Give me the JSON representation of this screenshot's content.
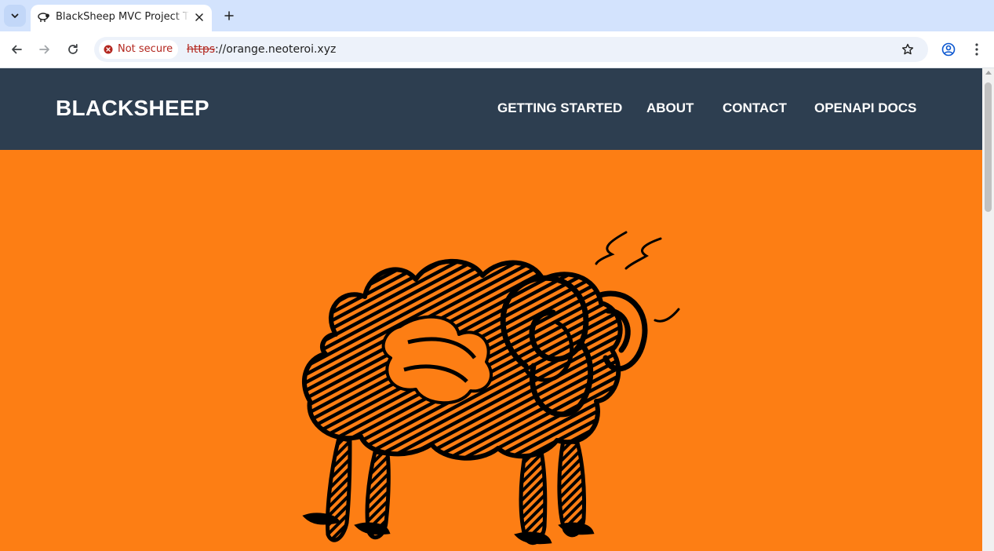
{
  "browser": {
    "tab": {
      "title": "BlackSheep MVC Project T",
      "favicon": "sheep-icon"
    },
    "security": {
      "label": "Not secure",
      "color": "#b3261e"
    },
    "address": {
      "scheme": "https",
      "rest": "://orange.neoteroi.xyz"
    },
    "icons": {
      "tab_search": "chevron-down-icon",
      "close": "close-icon",
      "new_tab": "plus-icon",
      "back": "back-arrow-icon",
      "forward": "forward-arrow-icon",
      "reload": "reload-icon",
      "bookmark": "star-icon",
      "profile": "profile-icon",
      "menu": "kebab-menu-icon"
    }
  },
  "page": {
    "brand": "BLACKSHEEP",
    "nav": [
      {
        "label": "GETTING STARTED"
      },
      {
        "label": "ABOUT"
      },
      {
        "label": "CONTACT"
      },
      {
        "label": "OPENAPI DOCS"
      }
    ],
    "colors": {
      "navbar": "#2d3e50",
      "hero": "#fd7e14",
      "ink": "#000000"
    },
    "hero_image": "black-sheep-illustration"
  }
}
